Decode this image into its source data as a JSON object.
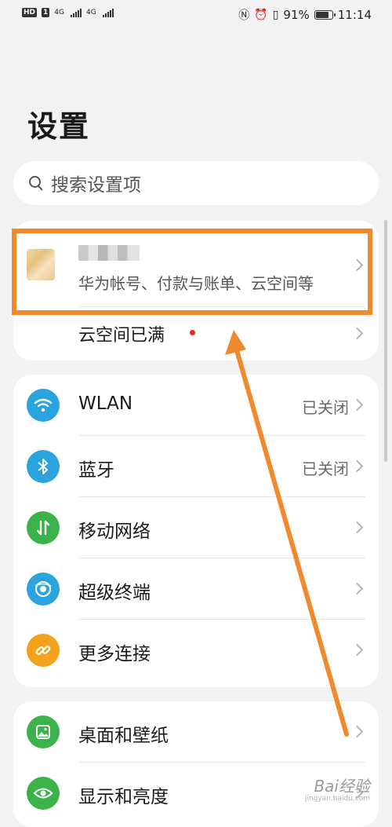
{
  "status_bar": {
    "left_chips": [
      "HD",
      "1",
      "4G",
      "4G"
    ],
    "battery_percent_text": "91%",
    "battery_level": 0.91,
    "time": "11:14"
  },
  "page": {
    "title": "设置"
  },
  "search": {
    "placeholder": "搜索设置项"
  },
  "account": {
    "subtitle": "华为帐号、付款与账单、云空间等",
    "cloud_label": "云空间已满",
    "cloud_badge_color": "#e02b2b"
  },
  "connections": {
    "items": [
      {
        "label": "WLAN",
        "value": "已关闭",
        "icon": "wifi-icon",
        "color": "#2aa3df"
      },
      {
        "label": "蓝牙",
        "value": "已关闭",
        "icon": "bluetooth-icon",
        "color": "#2aa3df"
      },
      {
        "label": "移动网络",
        "value": "",
        "icon": "mobile-data-icon",
        "color": "#3cb34a"
      },
      {
        "label": "超级终端",
        "value": "",
        "icon": "super-device-icon",
        "color": "#2aa3df"
      },
      {
        "label": "更多连接",
        "value": "",
        "icon": "link-icon",
        "color": "#f4a21b"
      }
    ]
  },
  "display": {
    "items": [
      {
        "label": "桌面和壁纸",
        "icon": "wallpaper-icon",
        "color": "#3cb34a"
      },
      {
        "label": "显示和亮度",
        "icon": "eye-icon",
        "color": "#3cb34a"
      }
    ]
  },
  "watermark": {
    "text": "Bai经验",
    "sub": "jingyan.baidu.com"
  },
  "annotation": {
    "color": "#f08a2c"
  }
}
